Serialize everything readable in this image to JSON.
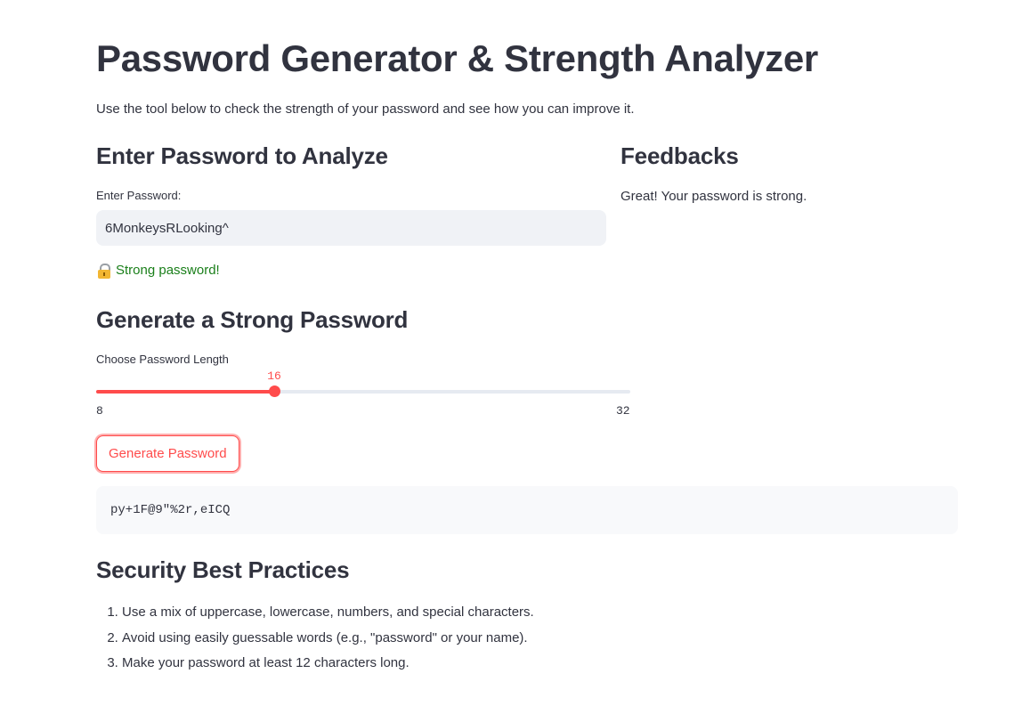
{
  "page": {
    "title": "Password Generator & Strength Analyzer",
    "intro": "Use the tool below to check the strength of your password and see how you can improve it."
  },
  "analyze": {
    "heading": "Enter Password to Analyze",
    "input_label": "Enter Password:",
    "input_value": "6MonkeysRLooking^",
    "strength_icon": "lock-icon",
    "strength_text": "Strong password!",
    "strength_color": "#1a7f1a"
  },
  "feedback": {
    "heading": "Feedbacks",
    "text": "Great! Your password is strong."
  },
  "generate": {
    "heading": "Generate a Strong Password",
    "slider_label": "Choose Password Length",
    "slider_min": 8,
    "slider_max": 32,
    "slider_value": 16,
    "min_label": "8",
    "max_label": "32",
    "value_label": "16",
    "button_label": "Generate Password",
    "generated_password": "py+1F@9\"%2r,eICQ",
    "accent_color": "#ff4b4b"
  },
  "practices": {
    "heading": "Security Best Practices",
    "items": [
      "Use a mix of uppercase, lowercase, numbers, and special characters.",
      "Avoid using easily guessable words (e.g., \"password\" or your name).",
      "Make your password at least 12 characters long."
    ]
  }
}
